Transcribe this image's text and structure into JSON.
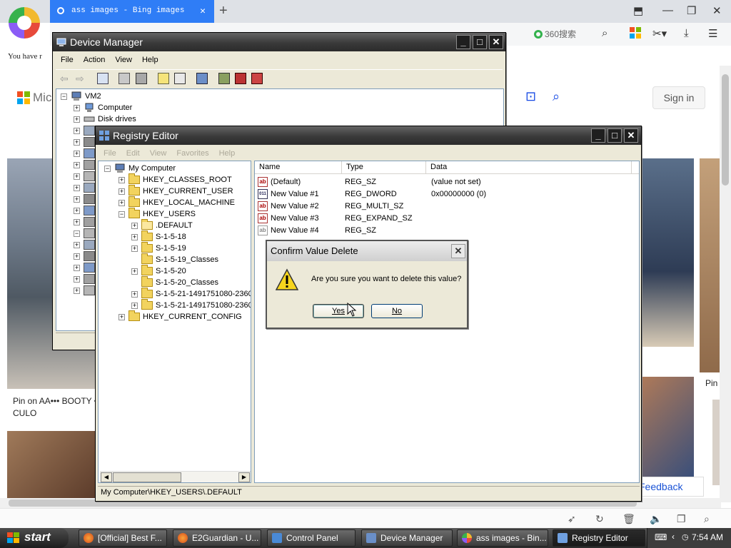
{
  "browser": {
    "tab_title": "ass images - Bing images",
    "search_engine_label": "360搜索",
    "notice_text": "You have r",
    "ms_text": "Mic",
    "signin_label": "Sign in",
    "caption_left": "Pin on AA••• BOOTY • CULO",
    "caption_left_2": "CULO",
    "caption_right_fragment": "Pin",
    "feedback_label": "Feedback"
  },
  "device_manager": {
    "title": "Device Manager",
    "menu": [
      "File",
      "Action",
      "View",
      "Help"
    ],
    "root": "VM2",
    "items": [
      "Computer",
      "Disk drives"
    ]
  },
  "registry_editor": {
    "title": "Registry Editor",
    "menu": [
      "File",
      "Edit",
      "View",
      "Favorites",
      "Help"
    ],
    "tree": {
      "root": "My Computer",
      "hives": [
        "HKEY_CLASSES_ROOT",
        "HKEY_CURRENT_USER",
        "HKEY_LOCAL_MACHINE",
        "HKEY_USERS"
      ],
      "users": [
        ".DEFAULT",
        "S-1-5-18",
        "S-1-5-19",
        "S-1-5-19_Classes",
        "S-1-5-20",
        "S-1-5-20_Classes",
        "S-1-5-21-1491751080-2360",
        "S-1-5-21-1491751080-2360"
      ],
      "last_hive": "HKEY_CURRENT_CONFIG"
    },
    "columns": [
      "Name",
      "Type",
      "Data"
    ],
    "values": [
      {
        "name": "(Default)",
        "type": "REG_SZ",
        "data": "(value not set)",
        "icon": "ab"
      },
      {
        "name": "New Value #1",
        "type": "REG_DWORD",
        "data": "0x00000000 (0)",
        "icon": "011"
      },
      {
        "name": "New Value #2",
        "type": "REG_MULTI_SZ",
        "data": "",
        "icon": "ab"
      },
      {
        "name": "New Value #3",
        "type": "REG_EXPAND_SZ",
        "data": "",
        "icon": "ab"
      },
      {
        "name": "New Value #4",
        "type": "REG_SZ",
        "data": "",
        "icon": "ab"
      }
    ],
    "status": "My Computer\\HKEY_USERS\\.DEFAULT"
  },
  "dialog": {
    "title": "Confirm Value Delete",
    "message": "Are you sure you want to delete this value?",
    "yes_label": "Yes",
    "no_label": "No"
  },
  "taskbar": {
    "start_label": "start",
    "tasks": [
      "[Official] Best F...",
      "E2Guardian - U...",
      "Control Panel",
      "Device Manager",
      "ass images - Bin...",
      "Registry Editor"
    ],
    "clock": "7:54 AM"
  },
  "colors": {
    "tab_blue": "#2f7df6",
    "bing_blue": "#174ae4",
    "xp_title_dark": "#3a3a3a",
    "xp_face": "#ece9d8"
  }
}
